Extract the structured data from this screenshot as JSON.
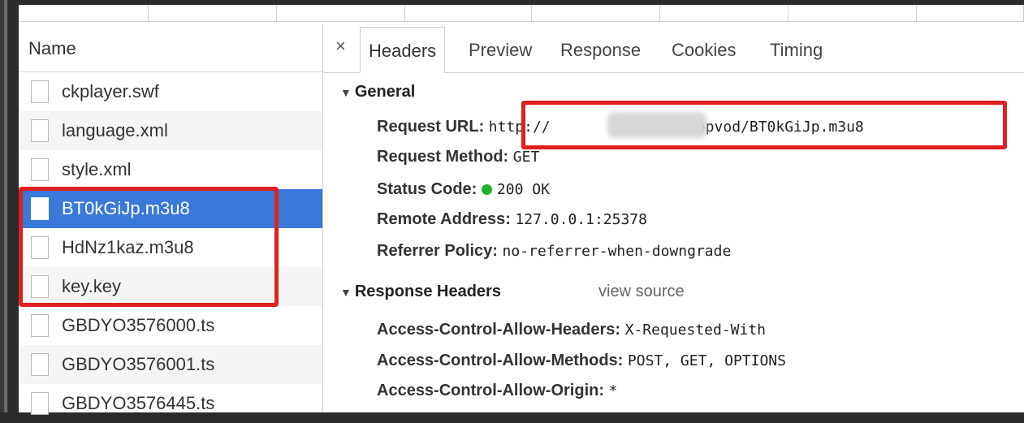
{
  "requests_panel": {
    "column_header": "Name",
    "rows": [
      {
        "name": "ckplayer.swf"
      },
      {
        "name": "language.xml"
      },
      {
        "name": "style.xml"
      },
      {
        "name": "BT0kGiJp.m3u8"
      },
      {
        "name": "HdNz1kaz.m3u8"
      },
      {
        "name": "key.key"
      },
      {
        "name": "GBDYO3576000.ts"
      },
      {
        "name": "GBDYO3576001.ts"
      },
      {
        "name": "GBDYO3576445.ts"
      }
    ],
    "selected": "BT0kGiJp.m3u8"
  },
  "detail_tabs": {
    "close": "×",
    "tabs": [
      "Headers",
      "Preview",
      "Response",
      "Cookies",
      "Timing"
    ],
    "active": "Headers"
  },
  "general": {
    "title": "General",
    "request_url_label": "Request URL:",
    "request_url_prefix": "http://",
    "request_url_suffix": "info/ppvod/BT0kGiJp.m3u8",
    "request_method_label": "Request Method:",
    "request_method_value": "GET",
    "status_code_label": "Status Code:",
    "status_code_value": "200 OK",
    "remote_address_label": "Remote Address:",
    "remote_address_value": "127.0.0.1:25378",
    "referrer_policy_label": "Referrer Policy:",
    "referrer_policy_value": "no-referrer-when-downgrade"
  },
  "response_headers": {
    "title": "Response Headers",
    "view_source": "view source",
    "items": [
      {
        "key": "Access-Control-Allow-Headers:",
        "value": "X-Requested-With"
      },
      {
        "key": "Access-Control-Allow-Methods:",
        "value": "POST, GET, OPTIONS"
      },
      {
        "key": "Access-Control-Allow-Origin:",
        "value": "*"
      }
    ]
  },
  "colors": {
    "selected_row": "#3879d9",
    "annotation_red": "#e02020",
    "status_green": "#22b22a"
  }
}
